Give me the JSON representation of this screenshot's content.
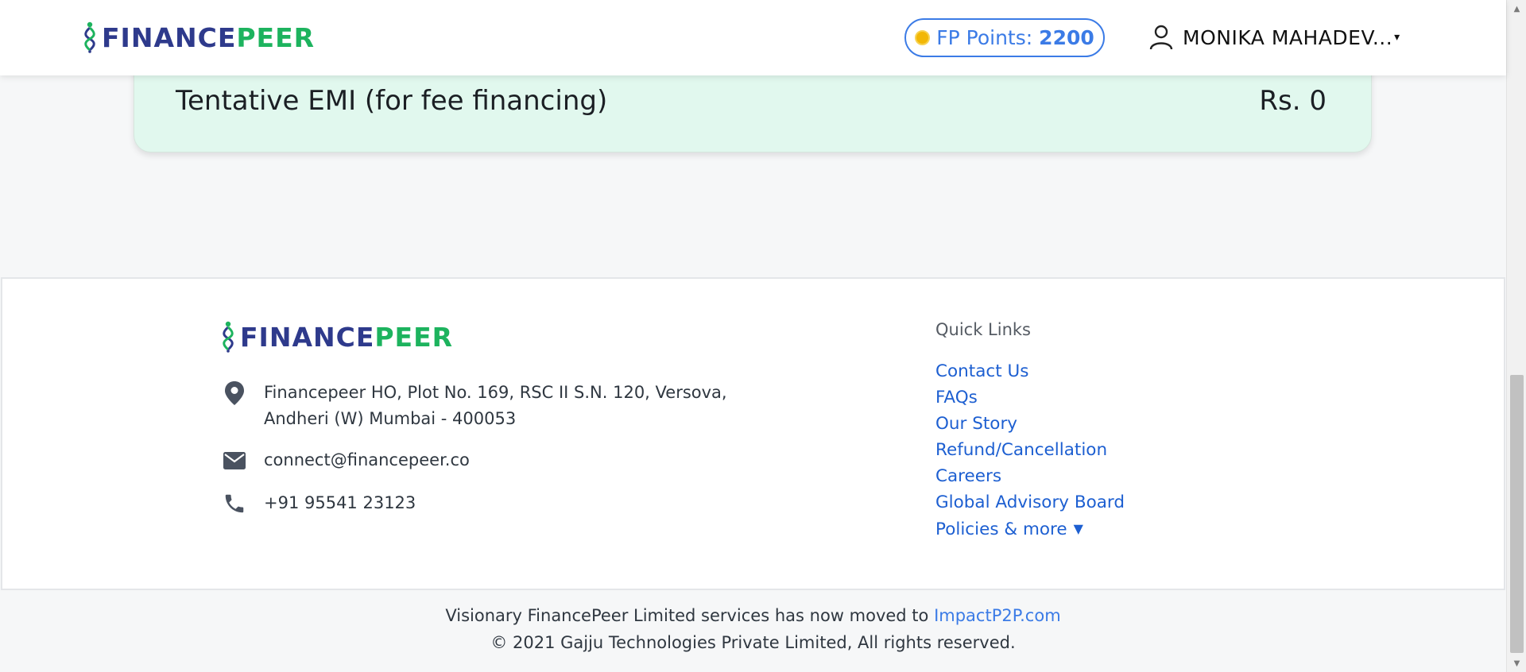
{
  "header": {
    "logo_part1": "FINANCE",
    "logo_part2": "PEER",
    "points_label": "FP Points:",
    "points_value": "2200",
    "user_name": "MONIKA MAHADEV...",
    "user_caret": "▾"
  },
  "emi": {
    "label": "Tentative EMI (for fee financing)",
    "value": "Rs. 0"
  },
  "footer": {
    "logo_part1": "FINANCE",
    "logo_part2": "PEER",
    "address_line1": "Financepeer HO, Plot No. 169, RSC II S.N. 120, Versova,",
    "address_line2": "Andheri (W) Mumbai - 400053",
    "email": "connect@financepeer.co",
    "phone": "+91 95541 23123",
    "quick_links_title": "Quick Links",
    "quick_links": [
      "Contact Us",
      "FAQs",
      "Our Story",
      "Refund/Cancellation",
      "Careers",
      "Global Advisory Board",
      "Policies & more"
    ]
  },
  "bottom": {
    "moved_text": "Visionary FinancePeer Limited services has now moved to",
    "moved_link": "ImpactP2P.com",
    "copyright": "© 2021 Gajju Technologies Private Limited, All rights reserved."
  },
  "colors": {
    "brand_blue": "#2e3a8c",
    "brand_green": "#1db35e",
    "link_blue": "#1d5fd1",
    "accent_blue": "#3b7be6",
    "emi_background": "#e1f8ee"
  }
}
